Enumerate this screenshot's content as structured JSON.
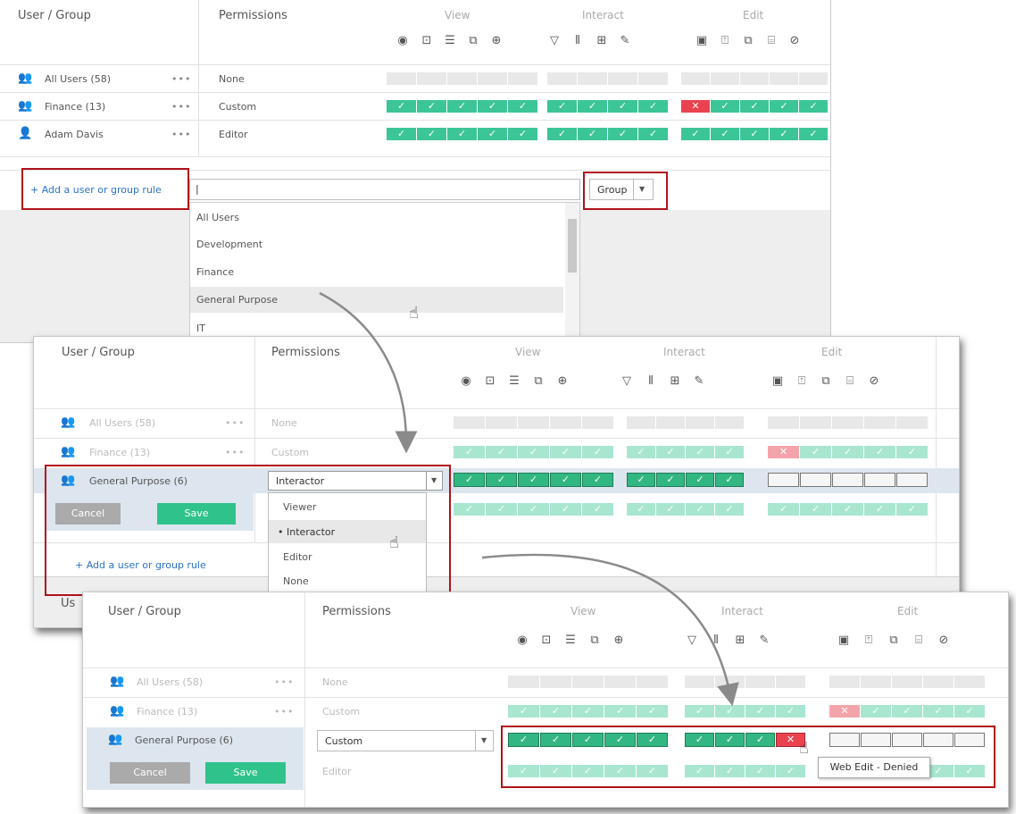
{
  "header": {
    "user_group": "User / Group",
    "permissions": "Permissions",
    "view": "View",
    "interact": "Interact",
    "edit": "Edit"
  },
  "panel1": {
    "rows": [
      {
        "name": "All Users (58)",
        "perm": "None"
      },
      {
        "name": "Finance (13)",
        "perm": "Custom"
      },
      {
        "name": "Adam Davis",
        "perm": "Editor"
      }
    ],
    "more": "•••",
    "add_rule": "+ Add a user or group rule",
    "group_select": "Group",
    "list": [
      "All Users",
      "Development",
      "Finance",
      "General Purpose",
      "IT"
    ]
  },
  "panel2": {
    "rows": [
      {
        "name": "All Users (58)",
        "perm": "None"
      },
      {
        "name": "Finance (13)",
        "perm": "Custom"
      },
      {
        "name": "General Purpose (6)",
        "perm": "Interactor"
      }
    ],
    "more": "•••",
    "cancel": "Cancel",
    "save": "Save",
    "add_rule": "+ Add a user or group rule",
    "options": [
      "Viewer",
      "• Interactor",
      "Editor",
      "None"
    ],
    "cut_label": "Us"
  },
  "panel3": {
    "rows": [
      {
        "name": "All Users (58)",
        "perm": "None"
      },
      {
        "name": "Finance (13)",
        "perm": "Custom"
      },
      {
        "name": "General Purpose (6)",
        "perm": "Custom"
      },
      {
        "name": "",
        "perm": "Editor"
      }
    ],
    "more": "•••",
    "cancel": "Cancel",
    "save": "Save",
    "tooltip": "Web Edit - Denied"
  },
  "symbols": {
    "check": "✓",
    "cross": "✕"
  },
  "icons": {
    "view": [
      "eye-icon",
      "picture-icon",
      "filter-list-icon",
      "comments-icon",
      "add-comment-icon"
    ],
    "interact": [
      "filter-icon",
      "sort-icon",
      "data-icon",
      "pencil-icon"
    ],
    "edit": [
      "save-icon",
      "export-icon",
      "share-icon",
      "trash-icon",
      "check-circle-icon"
    ]
  },
  "colors": {
    "green": "#3cc596",
    "light_green": "#a8e6cf",
    "red": "#e8434f",
    "highlight": "#3b3b3b",
    "red_box": "#b0121a",
    "link": "#2b72c9"
  }
}
